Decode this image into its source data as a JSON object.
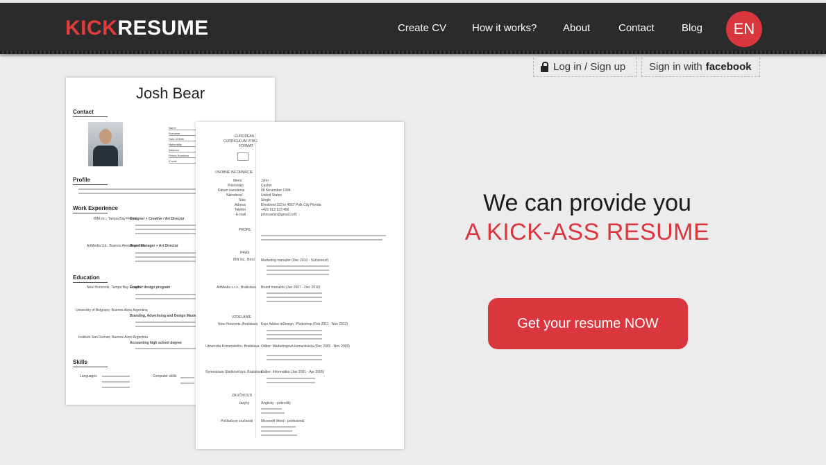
{
  "header": {
    "logo_kick": "KICK",
    "logo_resume": "RESUME",
    "nav": [
      {
        "label": "Create CV"
      },
      {
        "label": "How it works?"
      },
      {
        "label": "About"
      },
      {
        "label": "Contact"
      },
      {
        "label": "Blog"
      }
    ],
    "language": "EN"
  },
  "auth": {
    "login_label": "Log in",
    "separator": "/",
    "signup_label": "Sign up",
    "facebook_prefix": "Sign in with",
    "facebook_brand": "facebook"
  },
  "hero": {
    "line1": "We can provide you",
    "line2": "A KICK-ASS RESUME",
    "cta": "Get your resume NOW"
  },
  "cv_preview_1": {
    "name": "Josh Bear",
    "sections": [
      "Contact",
      "Profile",
      "Work Experience",
      "Education",
      "Skills"
    ],
    "fields": [
      "Name",
      "Surname",
      "Date of Birth",
      "Nationality",
      "Address",
      "Phone Numbers",
      "E-mail"
    ],
    "jobs": [
      {
        "company": "IBM inc., Tampa Bay Florida",
        "title": "Designer + Creative / Art Director"
      },
      {
        "company": "ArtMedia Ltd., Buenos Aires Argentina",
        "title": "Brand Manager + Art Director"
      }
    ],
    "education": [
      {
        "school": "New Horizonts, Tampa Bay Florida",
        "title": "Graphic design program"
      },
      {
        "school": "University of Belgrano, Buenos Aires Argentina",
        "title": "Branding, Advertising and Design Master's degree"
      },
      {
        "school": "Instituto San Roman, Buenos Aires Argentina",
        "title": "Accounting high school degree"
      }
    ],
    "skills": {
      "languages_label": "Languages",
      "computer_label": "Computer skills"
    }
  },
  "cv_preview_2": {
    "header": [
      "EUROPEAN",
      "CURRICULUM VITAE",
      "FORMAT"
    ],
    "sections": [
      "OSOBNÉ INFORMÁCIE",
      "PROFIL",
      "PRAX",
      "VZDELANIE",
      "ZRUČNOSTI"
    ],
    "personal": [
      {
        "k": "Meno",
        "v": "John"
      },
      {
        "k": "Priezvisko",
        "v": "Cashin"
      },
      {
        "k": "Dátum narodenia",
        "v": "08 November 1984"
      },
      {
        "k": "Národnosť",
        "v": "United States"
      },
      {
        "k": "Stav",
        "v": "Single"
      },
      {
        "k": "Adresa",
        "v": "Elmstreet 323 in 4567 Polk City Florida"
      },
      {
        "k": "Telefón",
        "v": "+421 912 123 456"
      },
      {
        "k": "E-mail",
        "v": "johncashin@gmail.com"
      }
    ],
    "jobs": [
      {
        "company": "IBN inc., Brno",
        "title": "Marketing manažér (Dec 2010 - Súčasnosť)"
      },
      {
        "company": "ArtMedia s.r.o., Bratislava",
        "title": "Brand manažér (Jan 2007 - Dec 2010)"
      }
    ],
    "education": [
      {
        "school": "New Horizonts, Bratislava",
        "title": "Kurz Adobe InDesign, Photoshop (Feb 2011 - Nov 2012)"
      },
      {
        "school": "Univerzita Komenského, Bratislava",
        "title": "Odbor: Marketingová komunikácia (Dec 2005 - Nov 2009)"
      },
      {
        "school": "Gymnázium Sladkovičova, Bratislava",
        "title": "Odbor: Informatika (Jan 2001 - Apr 2005)"
      }
    ],
    "skills": [
      {
        "k": "Jazyky",
        "v": "Anglicky - pokročilý"
      },
      {
        "k": "Počítačové zručnosti",
        "v": "Microsoft Word - profesionál"
      }
    ]
  }
}
